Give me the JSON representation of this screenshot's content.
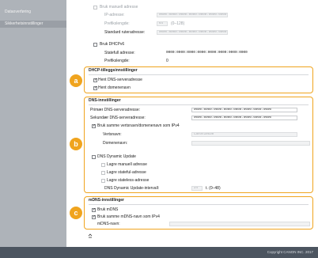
{
  "sidebar": {
    "items": [
      {
        "label": "Dataoverføring"
      },
      {
        "label": "Sikkerhetsinnstillinger"
      }
    ]
  },
  "ipv6_section": {
    "manual_address_cb": "Bruk manuell adresse",
    "ip_address_label": "IP-adresse:",
    "ip_address_value": "0000:0000:0000:0000:0000:0000:0000:0000",
    "prefix_label": "Prefikslengde:",
    "prefix_value": "64",
    "prefix_range": "(0–128)",
    "router_label": "Standard ruteradresse:",
    "router_value": "0000:0000:0000:0000:0000:0000:0000:0000",
    "dhcp_cb": "Bruk DHCPv6",
    "stateful_label": "Statefull adresse:",
    "stateful_value": "0000:0000:0000:0000:0000:0000:0000:0000",
    "prefix2_label": "Prefikslengde:",
    "prefix2_value": "0"
  },
  "dhcp": {
    "title": "DHCP-tilleggsinnstillinger",
    "dns_cb": "Hent DNS-serveradresse",
    "domain_cb": "Hent domenenavn"
  },
  "dns": {
    "title": "DNS-innstillinger",
    "primary_label": "Primær DNS-serveradresse:",
    "primary_value": "0000:0000:0000:0000:0000:0000:0000:0000",
    "secondary_label": "Sekundær DNS-serveradresse:",
    "secondary_value": "0000:0000:0000:0000:0000:0000:0000:0000",
    "same_host_cb": "Bruk samme vertsnavn/domenenavn som IPv4",
    "host_label": "Vertsnavn:",
    "host_value": "Canon10530",
    "domain_label": "Domenenavn:",
    "domain_value": "",
    "dynamic_cb": "DNS Dynamic Update",
    "save_manual_cb": "Lagre manuell adresse",
    "save_stateful_cb": "Lagre stateful-adresse",
    "save_stateless_cb": "Lagre stateless-adresse",
    "interval_label": "DNS Dynamic Update-intervall:",
    "interval_value": "24",
    "interval_range": "t. (0–48)"
  },
  "mdns": {
    "title": "mDNS-innstillinger",
    "use_cb": "Bruk mDNS",
    "same_name_cb": "Bruk samme mDNS-navn som IPv4",
    "name_label": "mDNS-navn:",
    "name_value": ""
  },
  "badges": {
    "a": "a",
    "b": "b",
    "c": "c"
  },
  "footer": {
    "copyright": "Copyright CANON INC. 2017"
  },
  "colors": {
    "accent": "#f0a41e",
    "footer_bg": "#4c5560",
    "sidebar_bg": "#aeb3b9"
  },
  "icons": {
    "scroll_top": "double-up-arrow-icon"
  }
}
